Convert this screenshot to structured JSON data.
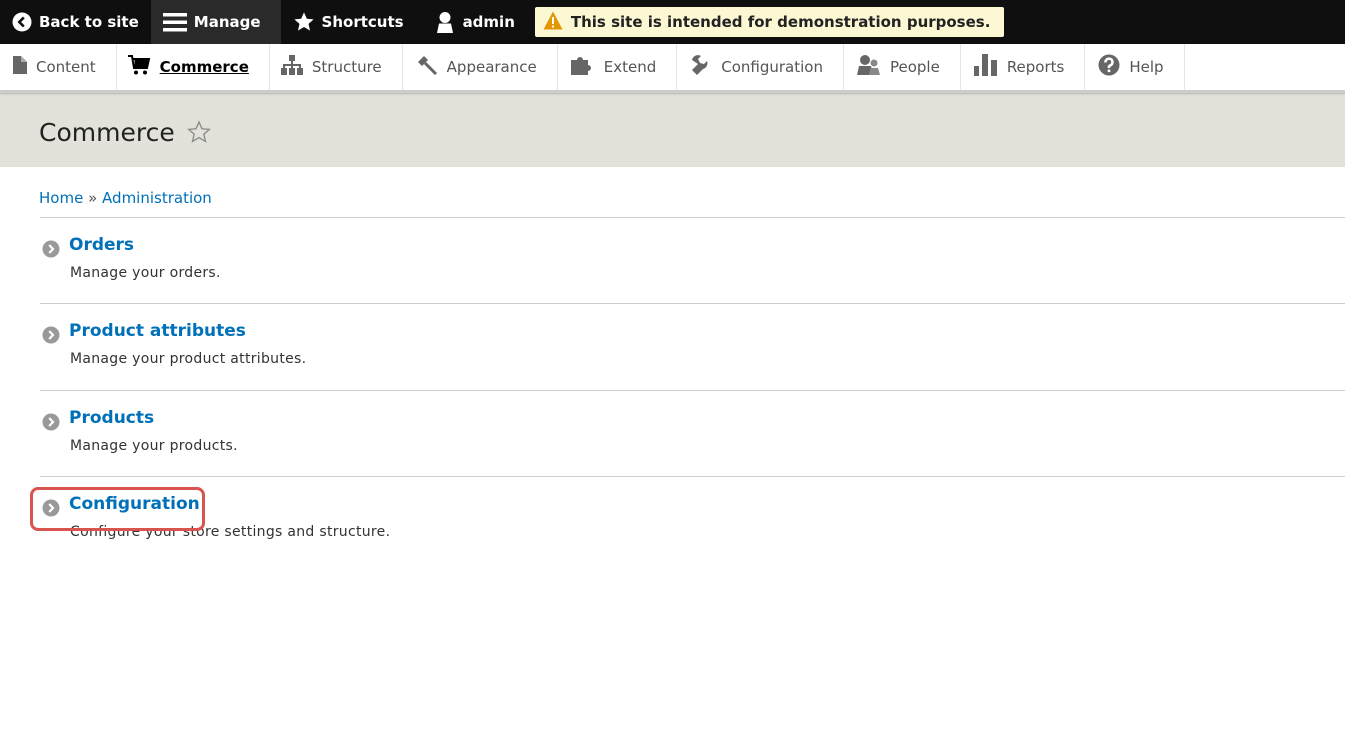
{
  "toolbar": {
    "back_label": "Back to site",
    "manage_label": "Manage",
    "shortcuts_label": "Shortcuts",
    "user_label": "admin",
    "notice": "This site is intended for demonstration purposes."
  },
  "tray": {
    "items": [
      {
        "label": "Content",
        "icon": "file-icon"
      },
      {
        "label": "Commerce",
        "icon": "cart-icon",
        "active": true
      },
      {
        "label": "Structure",
        "icon": "sitemap-icon"
      },
      {
        "label": "Appearance",
        "icon": "brush-icon"
      },
      {
        "label": "Extend",
        "icon": "puzzle-icon"
      },
      {
        "label": "Configuration",
        "icon": "wrench-icon"
      },
      {
        "label": "People",
        "icon": "people-icon"
      },
      {
        "label": "Reports",
        "icon": "bar-chart-icon"
      },
      {
        "label": "Help",
        "icon": "help-icon"
      }
    ]
  },
  "page": {
    "title": "Commerce"
  },
  "breadcrumb": {
    "home": "Home",
    "separator": "»",
    "admin": "Administration"
  },
  "admin_list": [
    {
      "title": "Orders",
      "description": "Manage your orders."
    },
    {
      "title": "Product attributes",
      "description": "Manage your product attributes."
    },
    {
      "title": "Products",
      "description": "Manage your products."
    },
    {
      "title": "Configuration",
      "description": "Configure your store settings and structure."
    }
  ],
  "colors": {
    "link": "#0071b8",
    "highlight": "#d9534f",
    "header_bg": "#e2e1da",
    "notice_bg": "#fdf8d4"
  }
}
